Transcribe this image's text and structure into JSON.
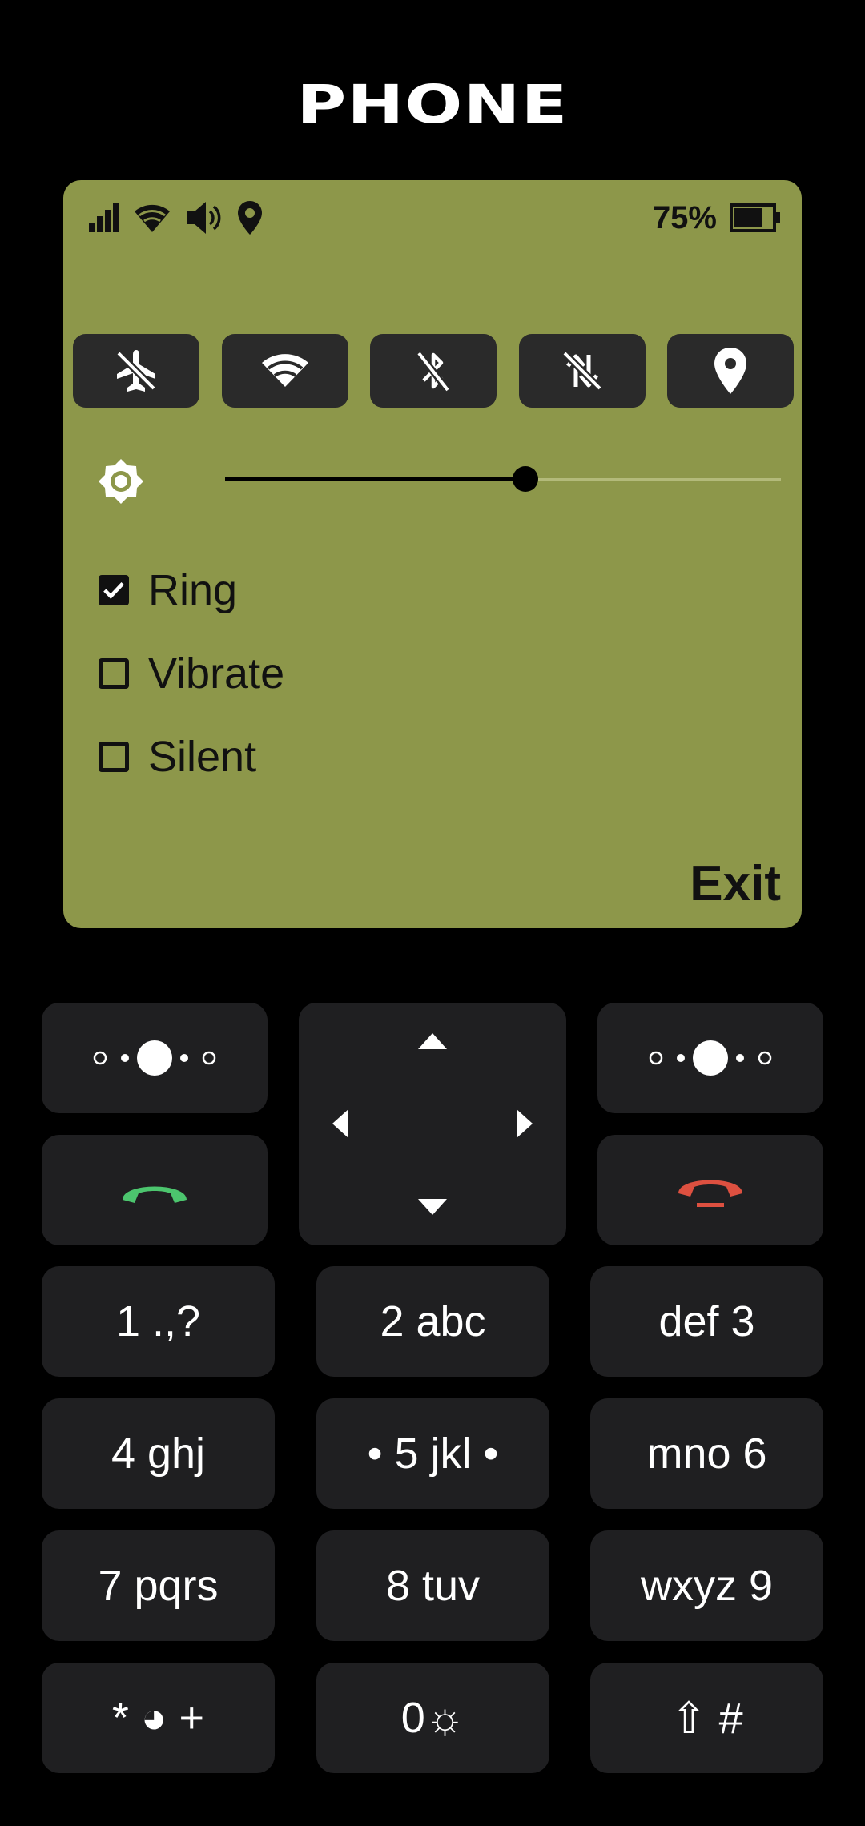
{
  "app": {
    "title": "PHONE"
  },
  "status": {
    "icons": [
      "signal-icon",
      "wifi-icon",
      "volume-icon",
      "location-icon"
    ],
    "battery_percent": "75%",
    "battery_level": 0.75
  },
  "quick_toggles": [
    {
      "name": "airplane-mode",
      "icon": "airplane-off-icon"
    },
    {
      "name": "wifi",
      "icon": "wifi-icon"
    },
    {
      "name": "bluetooth",
      "icon": "bluetooth-off-icon"
    },
    {
      "name": "mobile-data",
      "icon": "data-off-icon"
    },
    {
      "name": "location",
      "icon": "location-icon"
    }
  ],
  "brightness": {
    "icon": "brightness-icon",
    "level": 0.54
  },
  "sound_modes": [
    {
      "label": "Ring",
      "checked": true
    },
    {
      "label": "Vibrate",
      "checked": false
    },
    {
      "label": "Silent",
      "checked": false
    }
  ],
  "softkey_right": "Exit",
  "keypad": {
    "keys": [
      "1 .,?",
      "2 abc",
      "def 3",
      "4 ghj",
      "• 5 jkl •",
      "mno 6",
      "7 pqrs",
      "8 tuv",
      "wxyz 9",
      "* ◕ +",
      "0☼",
      "⇧ #"
    ]
  },
  "colors": {
    "screen_bg": "#8d974a",
    "call_green": "#4cc56e",
    "end_red": "#dd5040",
    "key_bg": "#1f1f21"
  }
}
